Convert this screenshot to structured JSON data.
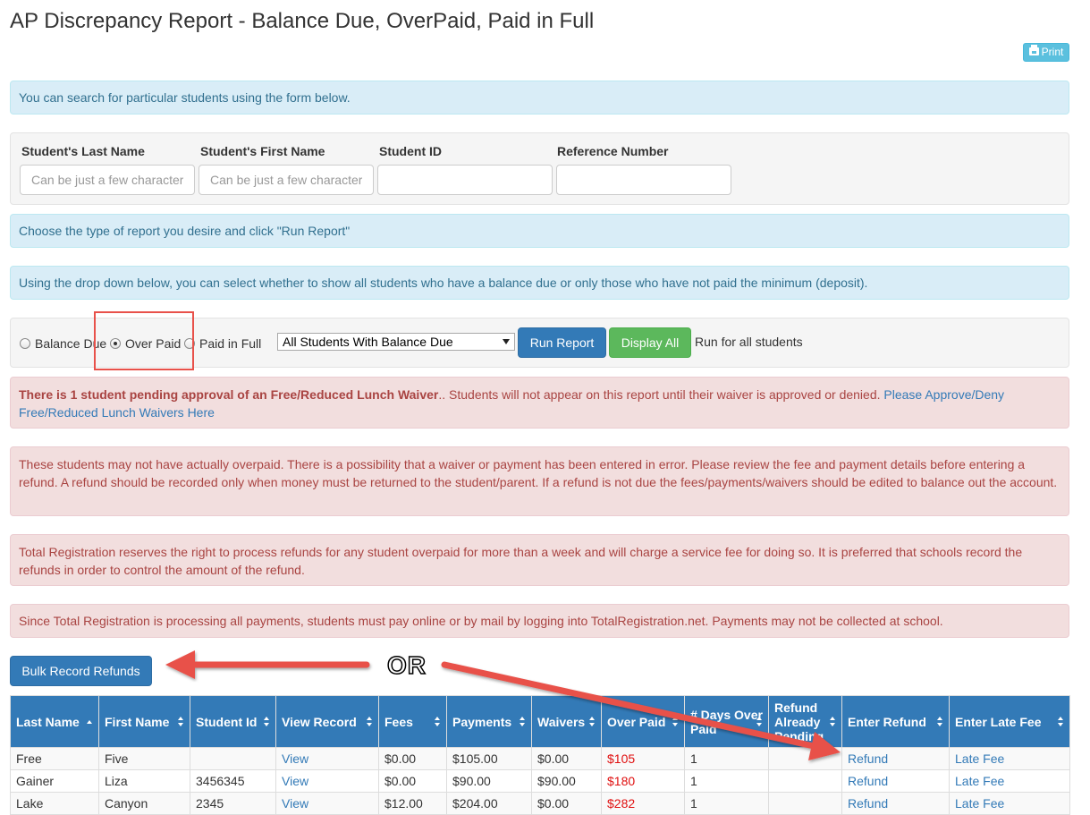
{
  "page": {
    "title": "AP Discrepancy Report - Balance Due, OverPaid, Paid in Full",
    "print_label": "Print"
  },
  "search_info": "You can search for particular students using the form below.",
  "search_form": {
    "last_name_label": "Student's Last Name",
    "last_name_placeholder": "Can be just a few characters",
    "first_name_label": "Student's First Name",
    "first_name_placeholder": "Can be just a few characters",
    "student_id_label": "Student ID",
    "reference_label": "Reference Number"
  },
  "report_info": "Choose the type of report you desire and click \"Run Report\"",
  "dropdown_info": "Using the drop down below, you can select whether to show all students who have a balance due or only those who have not paid the minimum (deposit).",
  "report_options": {
    "balance_due": "Balance Due",
    "over_paid": "Over Paid",
    "paid_in_full": "Paid in Full",
    "selected": "over_paid",
    "select_value": "All Students With Balance Due",
    "run_report": "Run Report",
    "display_all": "Display All",
    "run_all_text": "Run for all students"
  },
  "alerts": {
    "waiver_bold": "There is 1 student pending approval of an Free/Reduced Lunch Waiver",
    "waiver_text": ".. Students will not appear on this report until their waiver is approved or denied. ",
    "waiver_link": "Please Approve/Deny Free/Reduced Lunch Waivers Here",
    "overpaid_notice": "These students may not have actually overpaid. There is a possibility that a waiver or payment has been entered in error. Please review the fee and payment details before entering a refund. A refund should be recorded only when money must be returned to the student/parent. If a refund is not due the fees/payments/waivers should be edited to balance out the account.",
    "refund_notice": "Total Registration reserves the right to process refunds for any student overpaid for more than a week and will charge a service fee for doing so. It is preferred that schools record the refunds in order to control the amount of the refund.",
    "payment_notice": "Since Total Registration is processing all payments, students must pay online or by mail by logging into TotalRegistration.net. Payments may not be collected at school."
  },
  "bulk_button": "Bulk Record Refunds",
  "annotation": {
    "or_text": "OR",
    "arrow_color": "#e8514a"
  },
  "table": {
    "headers": [
      "Last Name",
      "First Name",
      "Student Id",
      "View Record",
      "Fees",
      "Payments",
      "Waivers",
      "Over Paid",
      "# Days Over Paid",
      "Refund Already Pending",
      "Enter Refund",
      "Enter Late Fee"
    ],
    "rows": [
      [
        "Free",
        "Five",
        "",
        "View",
        "$0.00",
        "$105.00",
        "$0.00",
        "$105",
        "1",
        "",
        "Refund",
        "Late Fee"
      ],
      [
        "Gainer",
        "Liza",
        "3456345",
        "View",
        "$0.00",
        "$90.00",
        "$90.00",
        "$180",
        "1",
        "",
        "Refund",
        "Late Fee"
      ],
      [
        "Lake",
        "Canyon",
        "2345",
        "View",
        "$12.00",
        "$204.00",
        "$0.00",
        "$282",
        "1",
        "",
        "Refund",
        "Late Fee"
      ]
    ]
  },
  "colors": {
    "primary": "#337ab7",
    "success": "#5cb85c",
    "info_bg": "#d9edf7",
    "danger_bg": "#f2dede",
    "overpaid_red": "#e01010"
  }
}
